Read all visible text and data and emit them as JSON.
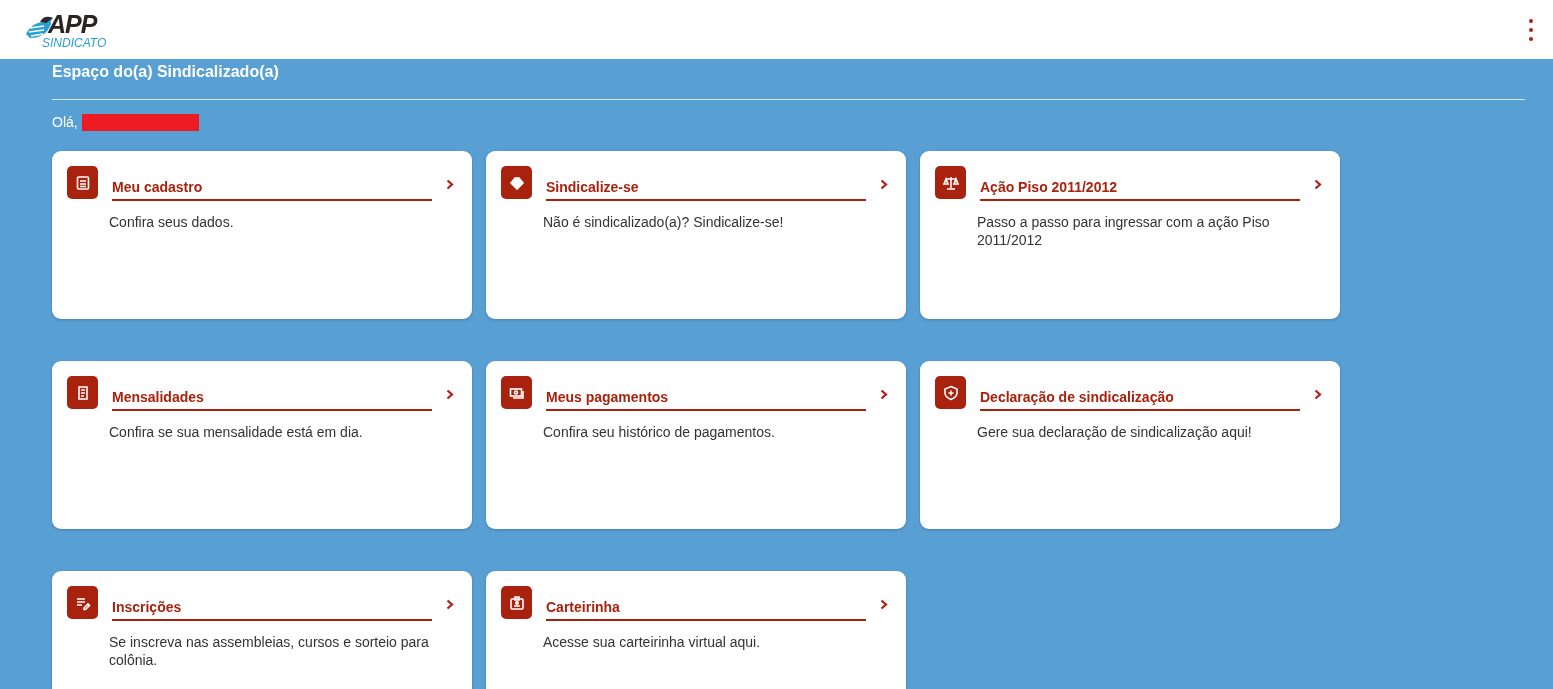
{
  "header": {
    "logo": {
      "title": "APP",
      "subtitle": "SINDICATO"
    }
  },
  "page": {
    "title": "Espaço do(a) Sindicalizado(a)",
    "greeting": "Olá,"
  },
  "cards": [
    {
      "title": "Meu cadastro",
      "description": "Confira seus dados."
    },
    {
      "title": "Sindicalize-se",
      "description": "Não é sindicalizado(a)? Sindicalize-se!"
    },
    {
      "title": "Ação Piso 2011/2012",
      "description": "Passo a passo para ingressar com a ação Piso 2011/2012"
    },
    {
      "title": "Mensalidades",
      "description": "Confira se sua mensalidade está em dia."
    },
    {
      "title": "Meus pagamentos",
      "description": "Confira seu histórico de pagamentos."
    },
    {
      "title": "Declaração de sindicalização",
      "description": "Gere sua declaração de sindicalização aqui!"
    },
    {
      "title": "Inscrições",
      "description": "Se inscreva nas assembleias, cursos e sorteio para colônia."
    },
    {
      "title": "Carteirinha",
      "description": "Acesse sua carteirinha virtual aqui."
    }
  ]
}
